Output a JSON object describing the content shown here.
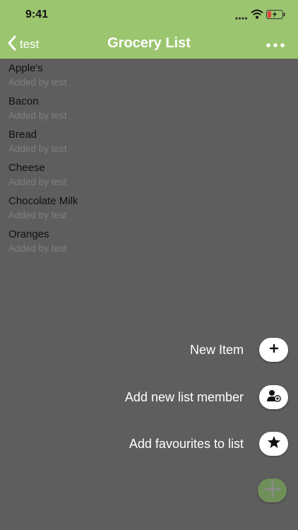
{
  "status_bar": {
    "time": "9:41",
    "signal_icon": "cellular-dots-icon",
    "wifi_icon": "wifi-icon",
    "battery_icon": "battery-charging-icon"
  },
  "nav": {
    "back_label": "test",
    "title": "Grocery List",
    "more_icon": "ellipsis-icon"
  },
  "items": [
    {
      "name": "Apple's",
      "subtitle": "Added by test"
    },
    {
      "name": "Bacon",
      "subtitle": "Added by test"
    },
    {
      "name": "Bread",
      "subtitle": "Added by test"
    },
    {
      "name": "Cheese",
      "subtitle": "Added by test"
    },
    {
      "name": "Chocolate Milk",
      "subtitle": "Added by test"
    },
    {
      "name": "Oranges",
      "subtitle": "Added by test"
    }
  ],
  "fab_menu": [
    {
      "label": "New Item",
      "icon": "plus-icon"
    },
    {
      "label": "Add new list member",
      "icon": "add-person-icon"
    },
    {
      "label": "Add favourites to list",
      "icon": "star-icon"
    }
  ],
  "colors": {
    "header": "#9bc56e",
    "overlay": "#5e5e5e",
    "main_fab": "#6f8f58"
  }
}
